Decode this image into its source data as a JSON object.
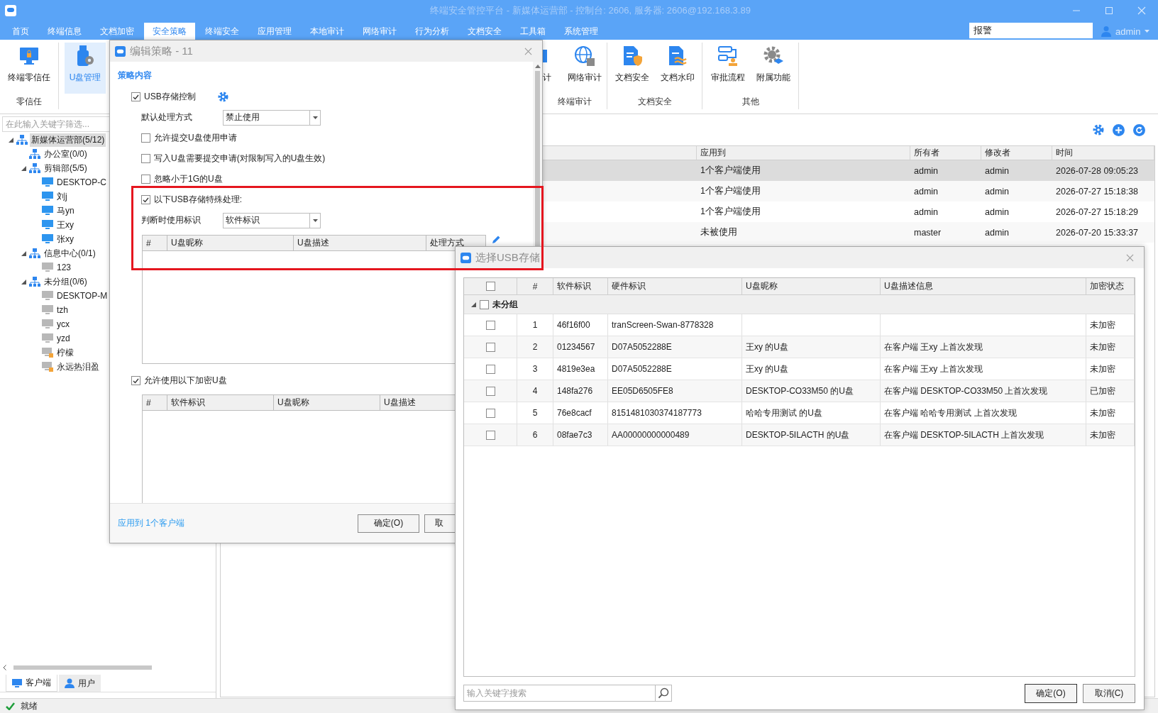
{
  "window": {
    "title": "终端安全管控平台 - 新媒体运营部 - 控制台: 2606, 服务器: 2606@192.168.3.89"
  },
  "menu": [
    {
      "label": "首页",
      "selected": false
    },
    {
      "label": "终端信息",
      "selected": false
    },
    {
      "label": "文档加密",
      "selected": false
    },
    {
      "label": "安全策略",
      "selected": true
    },
    {
      "label": "终端安全",
      "selected": false
    },
    {
      "label": "应用管理",
      "selected": false
    },
    {
      "label": "本地审计",
      "selected": false
    },
    {
      "label": "网络审计",
      "selected": false
    },
    {
      "label": "行为分析",
      "selected": false
    },
    {
      "label": "文档安全",
      "selected": false
    },
    {
      "label": "工具箱",
      "selected": false
    },
    {
      "label": "系统管理",
      "selected": false
    }
  ],
  "search": {
    "value": "报警"
  },
  "user": {
    "name": "admin"
  },
  "ribbon": {
    "left_groups": [
      {
        "label": "零信任",
        "buttons": [
          {
            "label": "终端零信任",
            "kind": "monitor",
            "selected": false
          }
        ]
      },
      {
        "buttons": [
          {
            "label": "U盘管理",
            "kind": "usb",
            "selected": true
          }
        ]
      }
    ],
    "right_groups": [
      {
        "label": "终端审计",
        "buttons": [
          {
            "label": "计",
            "kind": "cut",
            "selected": false
          },
          {
            "label": "网络审计",
            "kind": "globe",
            "selected": false
          }
        ]
      },
      {
        "label": "文档安全",
        "buttons": [
          {
            "label": "文档安全",
            "kind": "doc-shield",
            "selected": false
          },
          {
            "label": "文档水印",
            "kind": "doc-wave",
            "selected": false
          }
        ]
      },
      {
        "label": "其他",
        "buttons": [
          {
            "label": "审批流程",
            "kind": "flow",
            "selected": false
          },
          {
            "label": "附属功能",
            "kind": "gear",
            "selected": false
          }
        ]
      }
    ]
  },
  "left_panel": {
    "filter_placeholder": "在此输入关键字筛选...",
    "tree": [
      {
        "label": "新媒体运营部(5/12)",
        "kind": "group",
        "expanded": true,
        "selected": true,
        "children": [
          {
            "label": "办公室(0/0)",
            "kind": "group",
            "selected": false
          },
          {
            "label": "剪辑部(5/5)",
            "kind": "group",
            "expanded": true,
            "selected": false,
            "children": [
              {
                "label": "DESKTOP-C",
                "kind": "online",
                "selected": false
              },
              {
                "label": "刘j",
                "kind": "online",
                "selected": false
              },
              {
                "label": "马yn",
                "kind": "online",
                "selected": false
              },
              {
                "label": "王xy",
                "kind": "online",
                "selected": false
              },
              {
                "label": "张xy",
                "kind": "online",
                "selected": false
              }
            ]
          },
          {
            "label": "信息中心(0/1)",
            "kind": "group",
            "expanded": true,
            "selected": false,
            "children": [
              {
                "label": "123",
                "kind": "offline",
                "selected": false
              }
            ]
          },
          {
            "label": "未分组(0/6)",
            "kind": "group",
            "expanded": true,
            "selected": false,
            "children": [
              {
                "label": "DESKTOP-M",
                "kind": "offline",
                "selected": false
              },
              {
                "label": "tzh",
                "kind": "offline",
                "selected": false
              },
              {
                "label": "ycx",
                "kind": "offline",
                "selected": false
              },
              {
                "label": "yzd",
                "kind": "offline",
                "selected": false
              },
              {
                "label": "柠檬",
                "kind": "locked",
                "selected": false
              },
              {
                "label": "永远热泪盈",
                "kind": "locked",
                "selected": false
              }
            ]
          }
        ]
      }
    ],
    "tabs": [
      {
        "label": "客户端",
        "kind": "monitor",
        "selected": true
      },
      {
        "label": "用户",
        "kind": "person",
        "selected": false
      }
    ]
  },
  "policy_table": {
    "columns": [
      "应用到",
      "所有者",
      "修改者",
      "时间"
    ],
    "rows": [
      {
        "cells": [
          "1个客户端使用",
          "admin",
          "admin",
          "2026-07-28 09:05:23"
        ],
        "selected": true
      },
      {
        "cells": [
          "1个客户端使用",
          "admin",
          "admin",
          "2026-07-27 15:18:38"
        ],
        "selected": false
      },
      {
        "cells": [
          "1个客户端使用",
          "admin",
          "admin",
          "2026-07-27 15:18:29"
        ],
        "selected": false
      },
      {
        "cells": [
          "未被使用",
          "master",
          "admin",
          "2026-07-20 15:33:37"
        ],
        "selected": false
      }
    ]
  },
  "edit_dialog": {
    "title": "编辑策略 - 11",
    "section": "策略内容",
    "usb_control": {
      "label": "USB存储控制",
      "checked": true
    },
    "default_action": {
      "label": "默认处理方式",
      "value": "禁止使用"
    },
    "options": [
      {
        "label": "允许提交U盘使用申请",
        "checked": false
      },
      {
        "label": "写入U盘需要提交申请(对限制写入的U盘生效)",
        "checked": false
      },
      {
        "label": "忽略小于1G的U盘",
        "checked": false
      }
    ],
    "special": {
      "label": "以下USB存储特殊处理:",
      "checked": true
    },
    "identifier": {
      "label": "判断时使用标识",
      "value": "软件标识"
    },
    "special_table": {
      "columns": [
        "#",
        "U盘昵称",
        "U盘描述",
        "处理方式"
      ]
    },
    "encrypted": {
      "label": "允许使用以下加密U盘",
      "checked": true
    },
    "encrypted_table": {
      "columns": [
        "#",
        "软件标识",
        "U盘昵称",
        "U盘描述"
      ]
    },
    "apply_link": "应用到 1个客户端",
    "buttons": [
      "确定(O)",
      "取"
    ]
  },
  "usb_dialog": {
    "title": "选择USB存储",
    "columns": [
      "#",
      "软件标识",
      "硬件标识",
      "U盘昵称",
      "U盘描述信息",
      "加密状态"
    ],
    "select_all": {
      "checked": false
    },
    "group": {
      "label": "未分组",
      "expanded": true,
      "checked": false
    },
    "rows": [
      {
        "checked": false,
        "cells": [
          "1",
          "46f16f00",
          "tranScreen-Swan-8778328",
          "",
          "",
          "未加密"
        ]
      },
      {
        "checked": false,
        "cells": [
          "2",
          "01234567",
          "D07A5052288E",
          "王xy 的U盘",
          "在客户端 王xy 上首次发现",
          "未加密"
        ]
      },
      {
        "checked": false,
        "cells": [
          "3",
          "4819e3ea",
          "D07A5052288E",
          "王xy 的U盘",
          "在客户端 王xy 上首次发现",
          "未加密"
        ]
      },
      {
        "checked": false,
        "cells": [
          "4",
          "148fa276",
          "EE05D6505FE8",
          "DESKTOP-CO33M50 的U盘",
          "在客户端 DESKTOP-CO33M50 上首次发现",
          "已加密"
        ]
      },
      {
        "checked": false,
        "cells": [
          "5",
          "76e8cacf",
          "8151481030374187773",
          "哈哈专用测试 的U盘",
          "在客户端 哈哈专用测试 上首次发现",
          "未加密"
        ]
      },
      {
        "checked": false,
        "cells": [
          "6",
          "08fae7c3",
          "AA00000000000489",
          "DESKTOP-5ILACTH 的U盘",
          "在客户端 DESKTOP-5ILACTH 上首次发现",
          "未加密"
        ]
      }
    ],
    "search_placeholder": "输入关键字搜索",
    "buttons": [
      "确定(O)",
      "取消(C)"
    ]
  },
  "status": "就绪"
}
